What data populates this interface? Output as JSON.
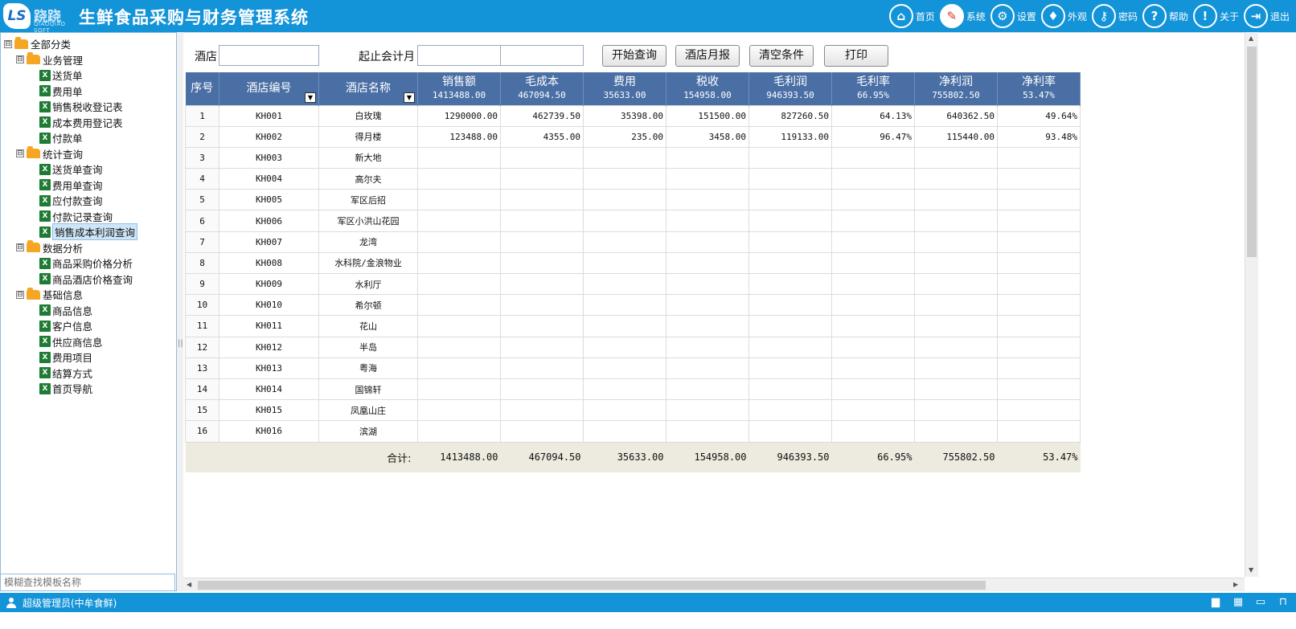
{
  "app": {
    "logo_text": "跷跷",
    "logo_badge": "LS",
    "logo_sub": "QIAOQIAO SOFT",
    "title": "生鲜食品采购与财务管理系统"
  },
  "topnav": [
    {
      "label": "首页",
      "icon": "home-icon",
      "glyph": "⌂"
    },
    {
      "label": "系统",
      "icon": "clipboard-icon",
      "glyph": "✎"
    },
    {
      "label": "设置",
      "icon": "gear-icon",
      "glyph": "⚙"
    },
    {
      "label": "外观",
      "icon": "shirt-icon",
      "glyph": "♦"
    },
    {
      "label": "密码",
      "icon": "key-icon",
      "glyph": "⚷"
    },
    {
      "label": "帮助",
      "icon": "help-icon",
      "glyph": "?"
    },
    {
      "label": "关于",
      "icon": "info-icon",
      "glyph": "!"
    },
    {
      "label": "退出",
      "icon": "exit-icon",
      "glyph": "⇥"
    }
  ],
  "tree": {
    "root": "全部分类",
    "groups": [
      {
        "label": "业务管理",
        "items": [
          "送货单",
          "费用单",
          "销售税收登记表",
          "成本费用登记表",
          "付款单"
        ]
      },
      {
        "label": "统计查询",
        "items": [
          "送货单查询",
          "费用单查询",
          "应付款查询",
          "付款记录查询",
          "销售成本利润查询"
        ]
      },
      {
        "label": "数据分析",
        "items": [
          "商品采购价格分析",
          "商品酒店价格查询"
        ]
      },
      {
        "label": "基础信息",
        "items": [
          "商品信息",
          "客户信息",
          "供应商信息",
          "费用项目",
          "结算方式",
          "首页导航"
        ]
      }
    ],
    "selected": "销售成本利润查询",
    "toggle_glyph": "⊟",
    "xls_glyph": "X"
  },
  "search": {
    "placeholder": "模糊查找模板名称"
  },
  "query": {
    "hotel_label": "酒店",
    "hotel_value": "",
    "month_label": "起止会计月",
    "month_from": "",
    "month_to": "",
    "buttons": {
      "search": "开始查询",
      "monthly": "酒店月报",
      "clear": "清空条件",
      "print": "打印"
    }
  },
  "grid": {
    "columns": [
      {
        "label": "序号",
        "sub": ""
      },
      {
        "label": "酒店编号",
        "sub": ""
      },
      {
        "label": "酒店名称",
        "sub": ""
      },
      {
        "label": "销售额",
        "sub": "1413488.00"
      },
      {
        "label": "毛成本",
        "sub": "467094.50"
      },
      {
        "label": "费用",
        "sub": "35633.00"
      },
      {
        "label": "税收",
        "sub": "154958.00"
      },
      {
        "label": "毛利润",
        "sub": "946393.50"
      },
      {
        "label": "毛利率",
        "sub": "66.95%"
      },
      {
        "label": "净利润",
        "sub": "755802.50"
      },
      {
        "label": "净利率",
        "sub": "53.47%"
      }
    ],
    "filter_glyph": "▼",
    "rows": [
      [
        "1",
        "KH001",
        "白玫瑰",
        "1290000.00",
        "462739.50",
        "35398.00",
        "151500.00",
        "827260.50",
        "64.13%",
        "640362.50",
        "49.64%"
      ],
      [
        "2",
        "KH002",
        "得月楼",
        "123488.00",
        "4355.00",
        "235.00",
        "3458.00",
        "119133.00",
        "96.47%",
        "115440.00",
        "93.48%"
      ],
      [
        "3",
        "KH003",
        "新大地",
        "",
        "",
        "",
        "",
        "",
        "",
        "",
        ""
      ],
      [
        "4",
        "KH004",
        "高尔夫",
        "",
        "",
        "",
        "",
        "",
        "",
        "",
        ""
      ],
      [
        "5",
        "KH005",
        "军区后招",
        "",
        "",
        "",
        "",
        "",
        "",
        "",
        ""
      ],
      [
        "6",
        "KH006",
        "军区小洪山花园",
        "",
        "",
        "",
        "",
        "",
        "",
        "",
        ""
      ],
      [
        "7",
        "KH007",
        "龙湾",
        "",
        "",
        "",
        "",
        "",
        "",
        "",
        ""
      ],
      [
        "8",
        "KH008",
        "水科院/金浪物业",
        "",
        "",
        "",
        "",
        "",
        "",
        "",
        ""
      ],
      [
        "9",
        "KH009",
        "水利厅",
        "",
        "",
        "",
        "",
        "",
        "",
        "",
        ""
      ],
      [
        "10",
        "KH010",
        "希尔顿",
        "",
        "",
        "",
        "",
        "",
        "",
        "",
        ""
      ],
      [
        "11",
        "KH011",
        "花山",
        "",
        "",
        "",
        "",
        "",
        "",
        "",
        ""
      ],
      [
        "12",
        "KH012",
        "半岛",
        "",
        "",
        "",
        "",
        "",
        "",
        "",
        ""
      ],
      [
        "13",
        "KH013",
        "粤海",
        "",
        "",
        "",
        "",
        "",
        "",
        "",
        ""
      ],
      [
        "14",
        "KH014",
        "国锦轩",
        "",
        "",
        "",
        "",
        "",
        "",
        "",
        ""
      ],
      [
        "15",
        "KH015",
        "凤凰山庄",
        "",
        "",
        "",
        "",
        "",
        "",
        "",
        ""
      ],
      [
        "16",
        "KH016",
        "滨湖",
        "",
        "",
        "",
        "",
        "",
        "",
        "",
        ""
      ]
    ],
    "total": {
      "label": "合计:",
      "values": [
        "1413488.00",
        "467094.50",
        "35633.00",
        "154958.00",
        "946393.50",
        "66.95%",
        "755802.50",
        "53.47%"
      ]
    }
  },
  "statusbar": {
    "user": "超级管理员(中牟食鲜)",
    "icons": [
      "chat-icon",
      "grid-icon",
      "monitor-icon",
      "lock-icon"
    ]
  }
}
